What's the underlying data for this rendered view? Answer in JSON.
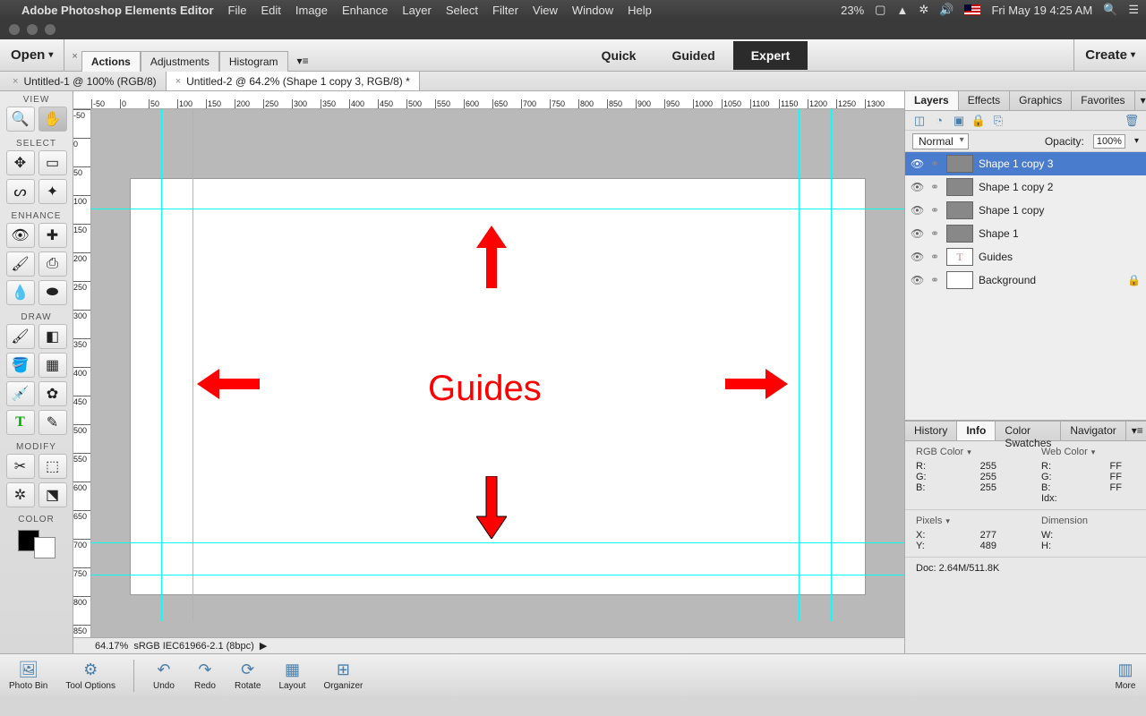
{
  "menubar": {
    "app": "Adobe Photoshop Elements Editor",
    "items": [
      "File",
      "Edit",
      "Image",
      "Enhance",
      "Layer",
      "Select",
      "Filter",
      "View",
      "Window",
      "Help"
    ],
    "battery": "23%",
    "clock": "Fri May 19  4:25 AM"
  },
  "topbar": {
    "open": "Open",
    "create": "Create",
    "action_tabs": [
      "Actions",
      "Adjustments",
      "Histogram"
    ],
    "modes": [
      "Quick",
      "Guided",
      "Expert"
    ],
    "active_mode": "Expert"
  },
  "doc_tabs": [
    {
      "label": "Untitled-1 @ 100% (RGB/8)",
      "active": false
    },
    {
      "label": "Untitled-2 @ 64.2% (Shape 1 copy 3, RGB/8) *",
      "active": true
    }
  ],
  "tool_sections": {
    "view": "VIEW",
    "select": "SELECT",
    "enhance": "ENHANCE",
    "draw": "DRAW",
    "modify": "MODIFY",
    "color": "COLOR"
  },
  "canvas_label": "Guides",
  "status": {
    "zoom": "64.17%",
    "profile": "sRGB IEC61966-2.1 (8bpc)"
  },
  "ruler_ticks": [
    "-50",
    "0",
    "50",
    "100",
    "150",
    "200",
    "250",
    "300",
    "350",
    "400",
    "450",
    "500",
    "550",
    "600",
    "650",
    "700",
    "750",
    "800",
    "850",
    "900",
    "950",
    "1000",
    "1050",
    "1100",
    "1150",
    "1200",
    "1250",
    "1300"
  ],
  "panels": {
    "top_tabs": [
      "Layers",
      "Effects",
      "Graphics",
      "Favorites"
    ],
    "blend_mode": "Normal",
    "opacity_label": "Opacity:",
    "opacity_value": "100%",
    "layers": [
      {
        "name": "Shape 1 copy 3",
        "sel": true,
        "thumb": "g"
      },
      {
        "name": "Shape 1 copy 2",
        "thumb": "g"
      },
      {
        "name": "Shape 1 copy",
        "thumb": "g"
      },
      {
        "name": "Shape 1",
        "thumb": "g"
      },
      {
        "name": "Guides",
        "thumb": "t"
      },
      {
        "name": "Background",
        "thumb": "w",
        "lock": true
      }
    ],
    "info_tabs": [
      "History",
      "Info",
      "Color Swatches",
      "Navigator"
    ],
    "rgb": {
      "title": "RGB Color",
      "R": "255",
      "G": "255",
      "B": "255"
    },
    "web": {
      "title": "Web Color",
      "R": "FF",
      "G": "FF",
      "B": "FF",
      "Idx": ""
    },
    "pixels": {
      "title": "Pixels",
      "X": "277",
      "Y": "489"
    },
    "dim": {
      "title": "Dimension",
      "W": "",
      "H": ""
    },
    "docsize": "Doc: 2.64M/511.8K"
  },
  "bottom": [
    "Photo Bin",
    "Tool Options",
    "Undo",
    "Redo",
    "Rotate",
    "Layout",
    "Organizer"
  ],
  "more": "More"
}
